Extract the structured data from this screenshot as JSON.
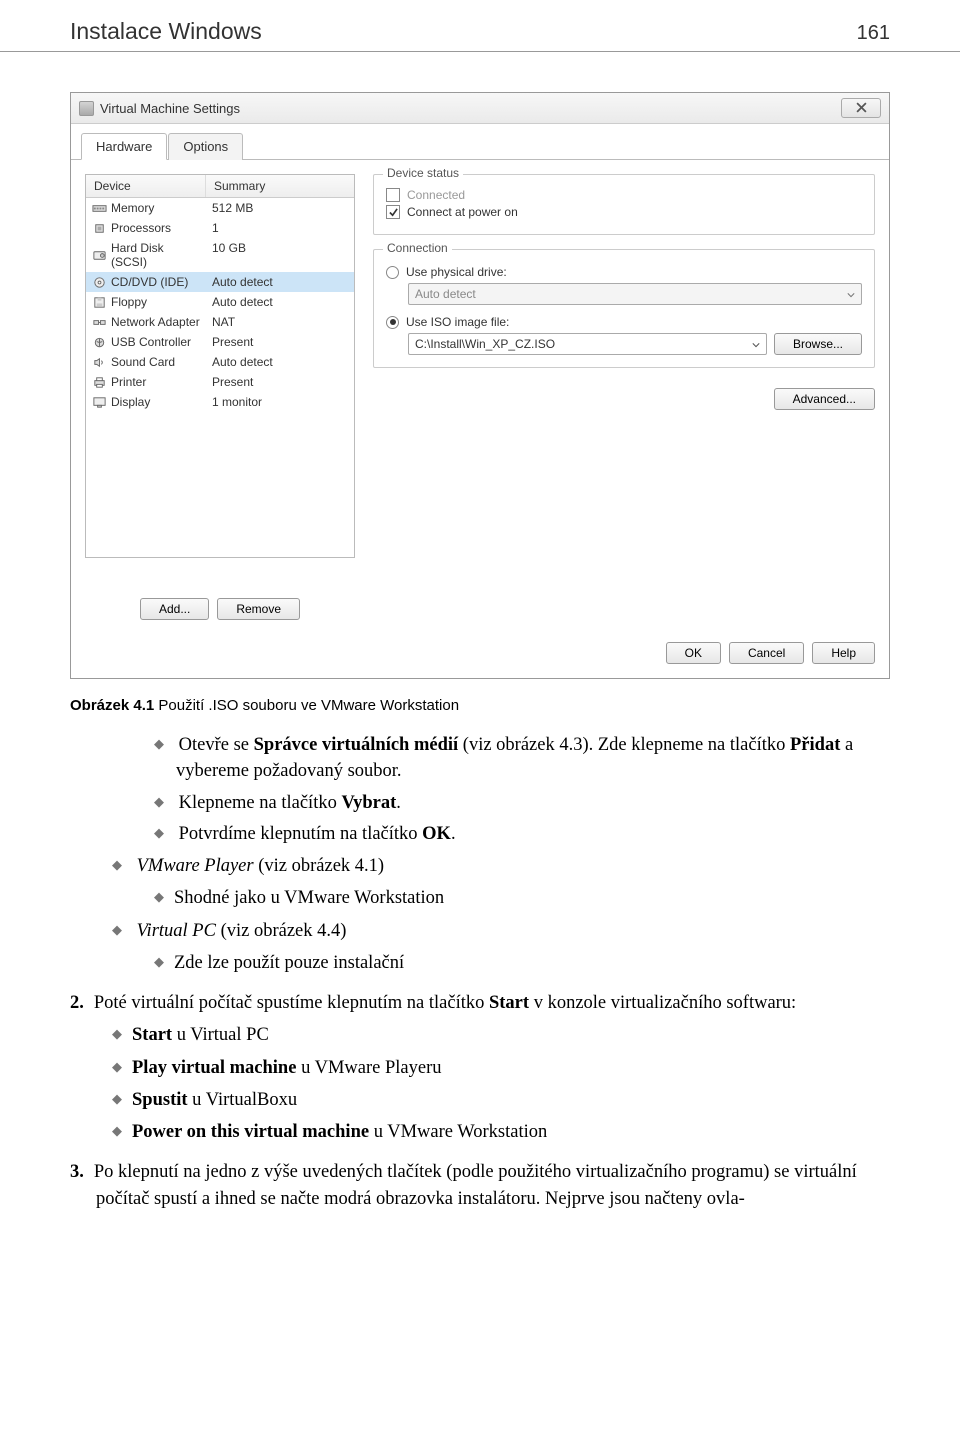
{
  "header": {
    "title": "Instalace Windows",
    "page": "161"
  },
  "dialog": {
    "title": "Virtual Machine Settings",
    "tabs": [
      "Hardware",
      "Options"
    ],
    "table": {
      "headers": [
        "Device",
        "Summary"
      ],
      "rows": [
        {
          "icon": "memory",
          "device": "Memory",
          "summary": "512 MB",
          "selected": false
        },
        {
          "icon": "cpu",
          "device": "Processors",
          "summary": "1",
          "selected": false
        },
        {
          "icon": "disk",
          "device": "Hard Disk (SCSI)",
          "summary": "10 GB",
          "selected": false
        },
        {
          "icon": "cd",
          "device": "CD/DVD (IDE)",
          "summary": "Auto detect",
          "selected": true
        },
        {
          "icon": "floppy",
          "device": "Floppy",
          "summary": "Auto detect",
          "selected": false
        },
        {
          "icon": "net",
          "device": "Network Adapter",
          "summary": "NAT",
          "selected": false
        },
        {
          "icon": "usb",
          "device": "USB Controller",
          "summary": "Present",
          "selected": false
        },
        {
          "icon": "sound",
          "device": "Sound Card",
          "summary": "Auto detect",
          "selected": false
        },
        {
          "icon": "printer",
          "device": "Printer",
          "summary": "Present",
          "selected": false
        },
        {
          "icon": "display",
          "device": "Display",
          "summary": "1 monitor",
          "selected": false
        }
      ]
    },
    "add_btn": "Add...",
    "remove_btn": "Remove",
    "status_legend": "Device status",
    "connected_label": "Connected",
    "connect_power_label": "Connect at power on",
    "connection_legend": "Connection",
    "use_physical_label": "Use physical drive:",
    "physical_value": "Auto detect",
    "use_iso_label": "Use ISO image file:",
    "iso_value": "C:\\Install\\Win_XP_CZ.ISO",
    "browse_btn": "Browse...",
    "advanced_btn": "Advanced...",
    "ok_btn": "OK",
    "cancel_btn": "Cancel",
    "help_btn": "Help"
  },
  "caption": {
    "label": "Obrázek 4.1",
    "text": " Použití .ISO souboru ve VMware Workstation"
  },
  "bullets": {
    "b1a": "Otevře se ",
    "b1b": "Správce virtuálních médií",
    "b1c": " (viz obrázek 4.3). Zde klepneme na tlačítko ",
    "b1d": "Při­dat",
    "b1e": " a vybereme požadovaný soubor.",
    "b2a": "Klepneme na tlačítko ",
    "b2b": "Vybrat",
    "b2c": ".",
    "b3a": "Potvrdíme klepnutím na tlačítko ",
    "b3b": "OK",
    "b3c": ".",
    "c1a": "VMware Player",
    "c1b": " (viz obrázek 4.1)",
    "c2": "Shodné jako u VMware Workstation",
    "d1a": "Virtual PC",
    "d1b": " (viz obrázek 4.4)",
    "d2": "Zde lze použít pouze instalační"
  },
  "num2": {
    "lead": "Poté virtuální počítač spustíme klepnutím na tlačítko ",
    "start": "Start",
    "tail": " v konzole virtualizačního softwaru:",
    "i1a": "Start",
    "i1b": " u Virtual PC",
    "i2a": "Play virtual machine",
    "i2b": " u VMware Playeru",
    "i3a": "Spustit",
    "i3b": " u VirtualBoxu",
    "i4a": "Power on this virtual machine",
    "i4b": " u VMware Workstation"
  },
  "num3": {
    "text": "Po klepnutí na jedno z výše uvedených tlačítek (podle použitého virtualizačního programu) se virtuální počítač spustí a ihned se načte modrá obrazovka instalátoru. Nejprve jsou načteny ovla-"
  }
}
